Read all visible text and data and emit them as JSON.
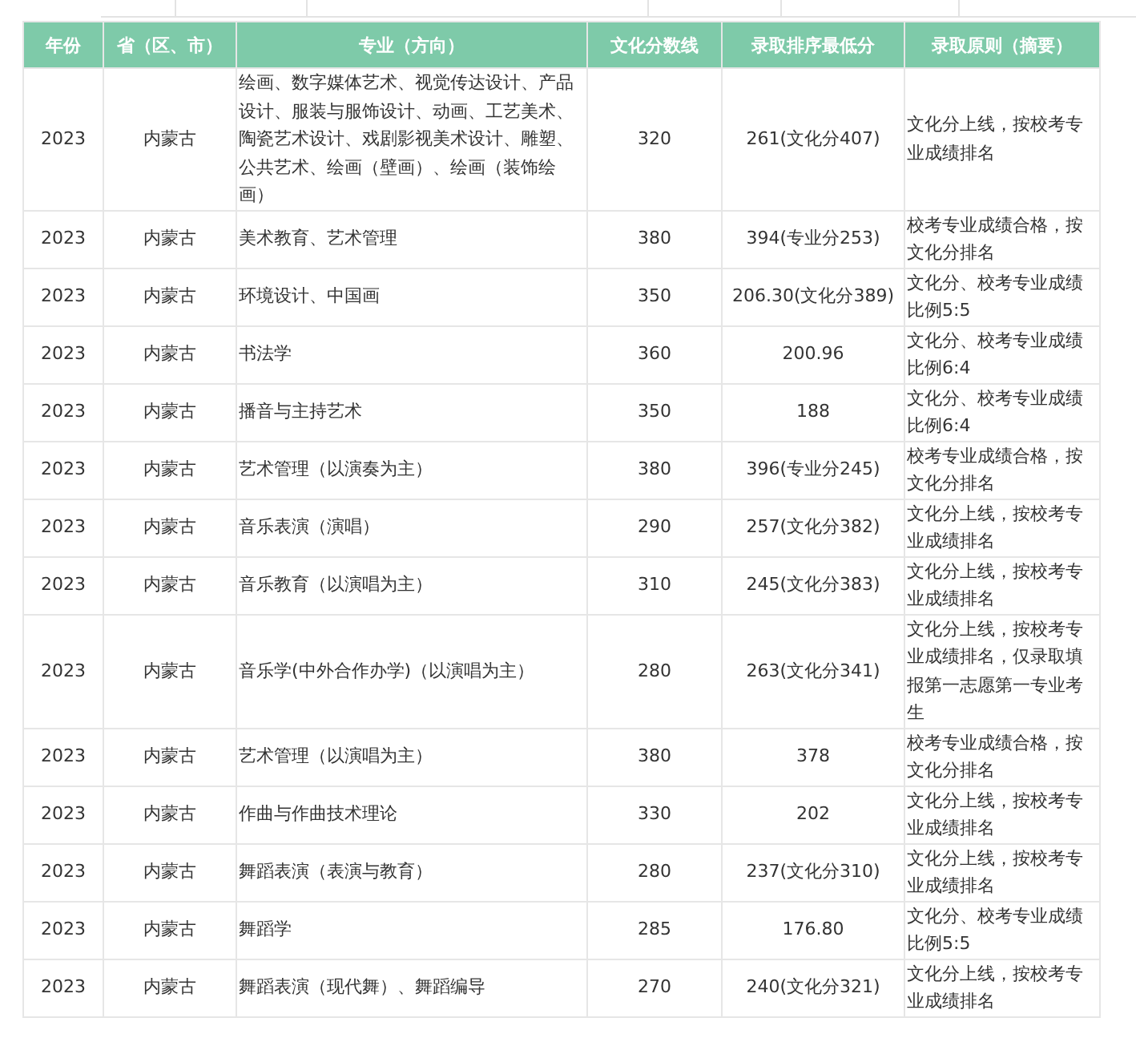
{
  "table": {
    "columns": [
      "年份",
      "省（区、市）",
      "专业（方向）",
      "文化分数线",
      "录取排序最低分",
      "录取原则（摘要）"
    ],
    "rows": [
      {
        "year": "2023",
        "region": "内蒙古",
        "major": "绘画、数字媒体艺术、视觉传达设计、产品设计、服装与服饰设计、动画、工艺美术、陶瓷艺术设计、戏剧影视美术设计、雕塑、公共艺术、绘画（壁画）、绘画（装饰绘画）",
        "culture_line": "320",
        "min_score": "261(文化分407)",
        "principle": "文化分上线，按校考专业成绩排名"
      },
      {
        "year": "2023",
        "region": "内蒙古",
        "major": "美术教育、艺术管理",
        "culture_line": "380",
        "min_score": "394(专业分253)",
        "principle": "校考专业成绩合格，按文化分排名"
      },
      {
        "year": "2023",
        "region": "内蒙古",
        "major": "环境设计、中国画",
        "culture_line": "350",
        "min_score": "206.30(文化分389)",
        "principle": "文化分、校考专业成绩比例5:5"
      },
      {
        "year": "2023",
        "region": "内蒙古",
        "major": "书法学",
        "culture_line": "360",
        "min_score": "200.96",
        "principle": "文化分、校考专业成绩比例6:4"
      },
      {
        "year": "2023",
        "region": "内蒙古",
        "major": "播音与主持艺术",
        "culture_line": "350",
        "min_score": "188",
        "principle": "文化分、校考专业成绩比例6:4"
      },
      {
        "year": "2023",
        "region": "内蒙古",
        "major": "艺术管理（以演奏为主）",
        "culture_line": "380",
        "min_score": "396(专业分245)",
        "principle": "校考专业成绩合格，按文化分排名"
      },
      {
        "year": "2023",
        "region": "内蒙古",
        "major": "音乐表演（演唱）",
        "culture_line": "290",
        "min_score": "257(文化分382)",
        "principle": "文化分上线，按校考专业成绩排名"
      },
      {
        "year": "2023",
        "region": "内蒙古",
        "major": "音乐教育（以演唱为主）",
        "culture_line": "310",
        "min_score": "245(文化分383)",
        "principle": "文化分上线，按校考专业成绩排名"
      },
      {
        "year": "2023",
        "region": "内蒙古",
        "major": "音乐学(中外合作办学)（以演唱为主）",
        "culture_line": "280",
        "min_score": "263(文化分341)",
        "principle": "文化分上线，按校考专业成绩排名，仅录取填报第一志愿第一专业考生"
      },
      {
        "year": "2023",
        "region": "内蒙古",
        "major": "艺术管理（以演唱为主）",
        "culture_line": "380",
        "min_score": "378",
        "principle": "校考专业成绩合格，按文化分排名"
      },
      {
        "year": "2023",
        "region": "内蒙古",
        "major": "作曲与作曲技术理论",
        "culture_line": "330",
        "min_score": "202",
        "principle": "文化分上线，按校考专业成绩排名"
      },
      {
        "year": "2023",
        "region": "内蒙古",
        "major": "舞蹈表演（表演与教育）",
        "culture_line": "280",
        "min_score": "237(文化分310)",
        "principle": "文化分上线，按校考专业成绩排名"
      },
      {
        "year": "2023",
        "region": "内蒙古",
        "major": "舞蹈学",
        "culture_line": "285",
        "min_score": "176.80",
        "principle": "文化分、校考专业成绩比例5:5"
      },
      {
        "year": "2023",
        "region": "内蒙古",
        "major": "舞蹈表演（现代舞）、舞蹈编导",
        "culture_line": "270",
        "min_score": "240(文化分321)",
        "principle": "文化分上线，按校考专业成绩排名"
      }
    ]
  }
}
